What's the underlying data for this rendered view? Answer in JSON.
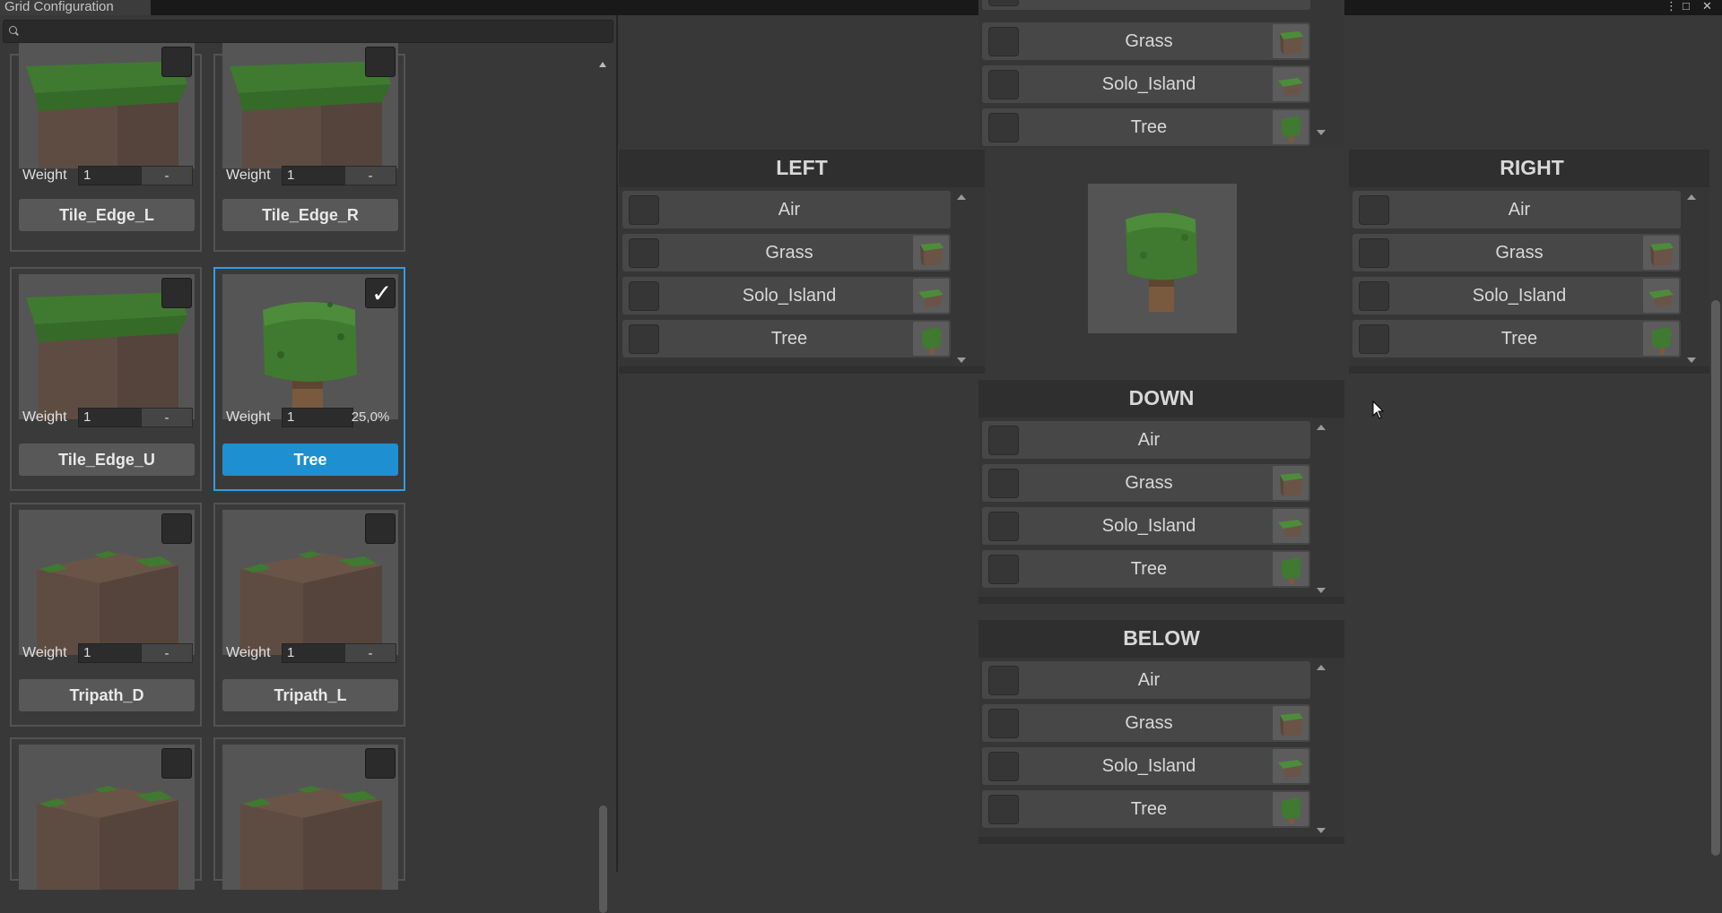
{
  "window": {
    "tab_title": "Grid Configuration",
    "controls": [
      "⋮",
      "□",
      "✕"
    ]
  },
  "search": {
    "placeholder": ""
  },
  "tiles": [
    {
      "name": "Tile_Edge_L",
      "weight_label": "Weight",
      "weight": "1",
      "percent": "-",
      "checked": false,
      "selected": false,
      "art": "edge"
    },
    {
      "name": "Tile_Edge_R",
      "weight_label": "Weight",
      "weight": "1",
      "percent": "-",
      "checked": false,
      "selected": false,
      "art": "edge"
    },
    {
      "name": "Tile_Edge_U",
      "weight_label": "Weight",
      "weight": "1",
      "percent": "-",
      "checked": false,
      "selected": false,
      "art": "edge"
    },
    {
      "name": "Tree",
      "weight_label": "Weight",
      "weight": "1",
      "percent": "25,0%",
      "checked": true,
      "selected": true,
      "art": "tree"
    },
    {
      "name": "Tripath_D",
      "weight_label": "Weight",
      "weight": "1",
      "percent": "-",
      "checked": false,
      "selected": false,
      "art": "tripath"
    },
    {
      "name": "Tripath_L",
      "weight_label": "Weight",
      "weight": "1",
      "percent": "-",
      "checked": false,
      "selected": false,
      "art": "tripath"
    },
    {
      "name": "",
      "checked": false,
      "selected": false,
      "art": "tripath"
    },
    {
      "name": "",
      "checked": false,
      "selected": false,
      "art": "tripath"
    }
  ],
  "neighbor_panels": {
    "up_partial": {
      "items": [
        "Grass",
        "Solo_Island",
        "Tree"
      ]
    },
    "left": {
      "title": "LEFT",
      "items": [
        "Air",
        "Grass",
        "Solo_Island",
        "Tree"
      ]
    },
    "right": {
      "title": "RIGHT",
      "items": [
        "Air",
        "Grass",
        "Solo_Island",
        "Tree"
      ]
    },
    "down": {
      "title": "DOWN",
      "items": [
        "Air",
        "Grass",
        "Solo_Island",
        "Tree"
      ]
    },
    "below": {
      "title": "BELOW",
      "items": [
        "Air",
        "Grass",
        "Solo_Island",
        "Tree"
      ]
    }
  },
  "colors": {
    "accent": "#1e8fd0",
    "selected_border": "#2e9ee6",
    "background": "#383838",
    "panel": "#2f2f2f"
  }
}
